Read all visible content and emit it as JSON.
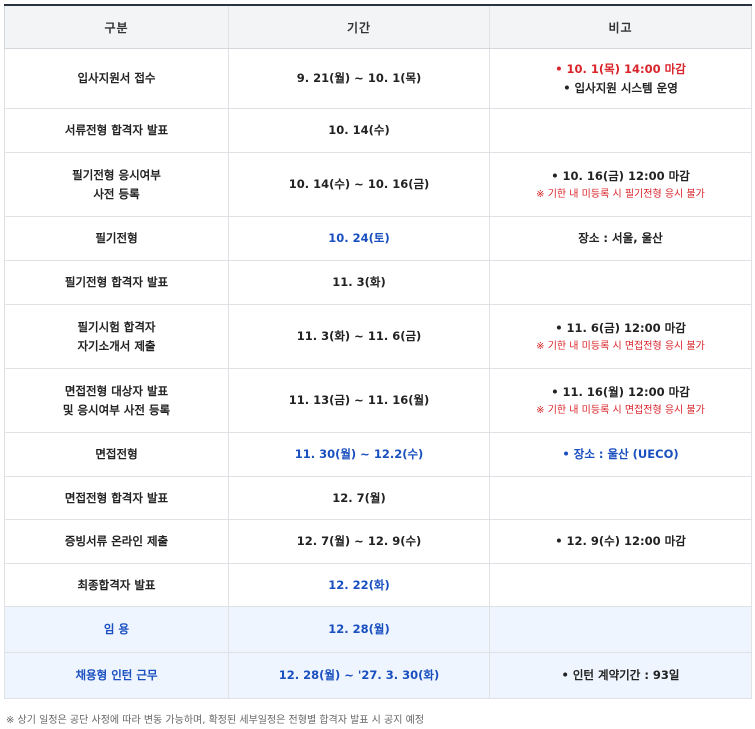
{
  "table": {
    "headers": [
      "구분",
      "기간",
      "비고"
    ],
    "rows": [
      {
        "name": "입사지원서 접수",
        "period": "9. 21(월) ~ 10. 1(목)",
        "remark_lines": [
          {
            "text": "• 10. 1(목) 14:00 마감",
            "style": "red"
          },
          {
            "text": "• 입사지원 시스템 운영",
            "style": "normal"
          }
        ],
        "height": 60
      },
      {
        "name": "서류전형 합격자 발표",
        "period": "10. 14(수)",
        "remark_lines": [],
        "height": 44
      },
      {
        "name": "필기전형 응시여부\n사전 등록",
        "period": "10. 14(수) ~ 10. 16(금)",
        "remark_lines": [
          {
            "text": "• 10. 16(금) 12:00 마감",
            "style": "normal"
          },
          {
            "text": "※ 기한 내 미등록 시 필기전형 응시 불가",
            "style": "small-red"
          }
        ],
        "height": 64
      },
      {
        "name": "필기전형",
        "period": "10. 24(토)",
        "period_color": "blue",
        "remark_lines": [
          {
            "text": "장소 : 서울, 울산",
            "style": "bold"
          }
        ],
        "height": 44
      },
      {
        "name": "필기전형 합격자 발표",
        "period": "11. 3(화)",
        "remark_lines": [],
        "height": 44
      },
      {
        "name": "필기시험 합격자\n자기소개서 제출",
        "period": "11. 3(화) ~ 11. 6(금)",
        "remark_lines": [
          {
            "text": "• 11. 6(금) 12:00 마감",
            "style": "normal"
          },
          {
            "text": "※ 기한 내 미등록 시 면접전형 응시 불가",
            "style": "small-red"
          }
        ],
        "height": 64
      },
      {
        "name": "면접전형 대상자 발표\n및 응시여부 사전 등록",
        "period": "11. 13(금) ~ 11. 16(월)",
        "remark_lines": [
          {
            "text": "• 11. 16(월) 12:00 마감",
            "style": "normal"
          },
          {
            "text": "※ 기한 내 미등록 시 면접전형 응시 불가",
            "style": "small-red"
          }
        ],
        "height": 64
      },
      {
        "name": "면접전형",
        "period": "11. 30(월) ~ 12.2(수)",
        "period_color": "blue",
        "remark_lines": [
          {
            "text": "• 장소 : 울산 (UECO)",
            "style": "blue-bold"
          }
        ],
        "height": 44
      },
      {
        "name": "면접전형 합격자 발표",
        "period": "12. 7(월)",
        "remark_lines": [],
        "height": 43
      },
      {
        "name": "증빙서류 온라인 제출",
        "period": "12. 7(월) ~ 12. 9(수)",
        "remark_lines": [
          {
            "text": "• 12. 9(수) 12:00 마감",
            "style": "normal"
          }
        ],
        "height": 44
      },
      {
        "name": "최종합격자 발표",
        "period": "12. 22(화)",
        "period_color": "blue",
        "remark_lines": [],
        "height": 43
      },
      {
        "name": "임 용",
        "period": "12. 28(월)",
        "name_color": "blue",
        "period_color": "blue",
        "highlight": true,
        "remark_lines": [],
        "height": 46
      },
      {
        "name": "채용형 인턴 근무",
        "period": "12. 28(월) ~ '27. 3. 30(화)",
        "name_color": "blue",
        "period_color": "blue",
        "highlight": true,
        "remark_lines": [
          {
            "text": "• 인턴 계약기간 : 93일",
            "style": "normal"
          }
        ],
        "height": 46
      }
    ]
  },
  "footnote": "※ 상기 일정은 공단 사정에 따라 변동 가능하며, 확정된 세부일정은 전형별 합격자 발표 시 공지 예정",
  "colors": {
    "blue": "#1a4fbf",
    "red": "#d9242a",
    "highlight_bg": "#eef5ff",
    "header_bg": "#f3f4f6"
  }
}
